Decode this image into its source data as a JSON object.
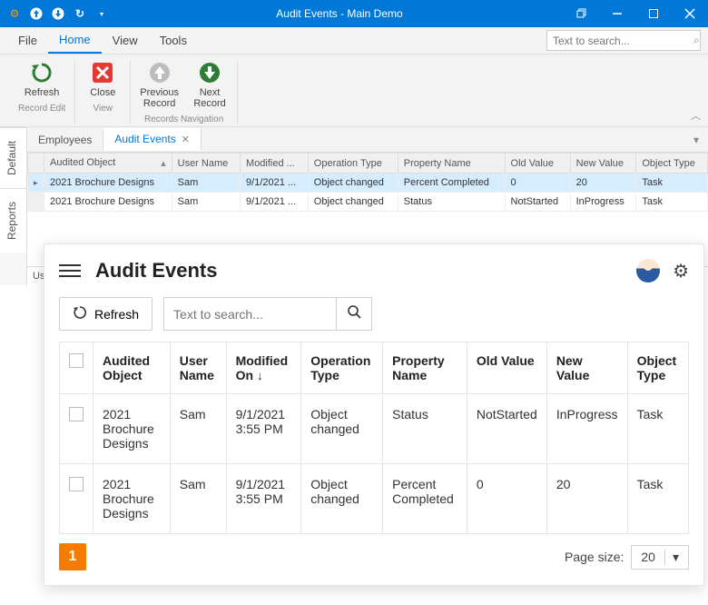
{
  "window": {
    "title": "Audit Events - Main Demo"
  },
  "menu": {
    "file": "File",
    "home": "Home",
    "view": "View",
    "tools": "Tools",
    "search_placeholder": "Text to search..."
  },
  "ribbon": {
    "refresh": "Refresh",
    "close": "Close",
    "prev": "Previous\nRecord",
    "next": "Next\nRecord",
    "g1": "Record Edit",
    "g2": "View",
    "g3": "Records Navigation"
  },
  "sidetabs": {
    "default": "Default",
    "reports": "Reports"
  },
  "doctabs": {
    "employees": "Employees",
    "audit": "Audit Events"
  },
  "ngrid": {
    "cols": {
      "ao": "Audited Object",
      "un": "User Name",
      "mo": "Modified ...",
      "ot": "Operation Type",
      "pn": "Property Name",
      "ov": "Old Value",
      "nv": "New Value",
      "obj": "Object Type"
    },
    "r0": {
      "ao": "2021 Brochure Designs",
      "un": "Sam",
      "mo": "9/1/2021 ...",
      "ot": "Object changed",
      "pn": "Percent Completed",
      "ov": "0",
      "nv": "20",
      "obj": "Task"
    },
    "r1": {
      "ao": "2021 Brochure Designs",
      "un": "Sam",
      "mo": "9/1/2021 ...",
      "ot": "Object changed",
      "pn": "Status",
      "ov": "NotStarted",
      "nv": "InProgress",
      "obj": "Task"
    }
  },
  "statusbar": {
    "user": "User: S"
  },
  "web": {
    "title": "Audit Events",
    "refresh": "Refresh",
    "search_placeholder": "Text to search...",
    "cols": {
      "ao": "Audited Object",
      "un": "User Name",
      "mo": "Modified On",
      "ot": "Operation Type",
      "pn": "Property Name",
      "ov": "Old Value",
      "nv": "New Value",
      "obj": "Object Type"
    },
    "r0": {
      "ao": "2021 Brochure Designs",
      "un": "Sam",
      "mo": "9/1/2021 3:55 PM",
      "ot": "Object changed",
      "pn": "Status",
      "ov": "NotStarted",
      "nv": "InProgress",
      "obj": "Task"
    },
    "r1": {
      "ao": "2021 Brochure Designs",
      "un": "Sam",
      "mo": "9/1/2021 3:55 PM",
      "ot": "Object changed",
      "pn": "Percent Completed",
      "ov": "0",
      "nv": "20",
      "obj": "Task"
    },
    "page": "1",
    "pagesize_label": "Page size:",
    "pagesize": "20"
  }
}
